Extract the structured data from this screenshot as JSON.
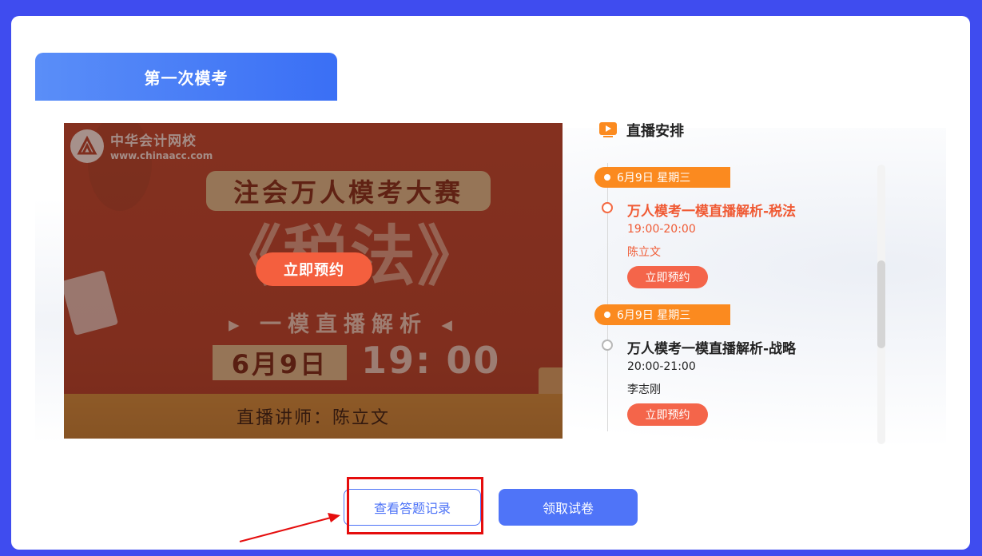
{
  "tab": {
    "title": "第一次模考"
  },
  "banner": {
    "logo_name": "中华会计网校",
    "logo_url": "www.chinaacc.com",
    "contest": "注会万人模考大赛",
    "subject": "《税法》",
    "sub_line": "▸ 一模直播解析 ◂",
    "date": "6月9日",
    "time": "19: 00",
    "teacher": "直播讲师：陈立文",
    "reserve_label": "立即预约"
  },
  "schedule": {
    "title": "直播安排",
    "groups": [
      {
        "date": "6月9日 星期三",
        "title": "万人模考一模直播解析-税法",
        "time": "19:00-20:00",
        "teacher": "陈立文",
        "button": "立即预约",
        "active": true
      },
      {
        "date": "6月9日 星期三",
        "title": "万人模考一模直播解析-战略",
        "time": "20:00-21:00",
        "teacher": "李志刚",
        "button": "立即预约",
        "active": false
      }
    ]
  },
  "actions": {
    "record_label": "查看答题记录",
    "get_paper_label": "领取试卷"
  },
  "colors": {
    "page_bg": "#3f4cef",
    "accent_blue": "#4f74f8",
    "accent_orange": "#fb8a1f",
    "highlight_red": "#e50d0d"
  }
}
